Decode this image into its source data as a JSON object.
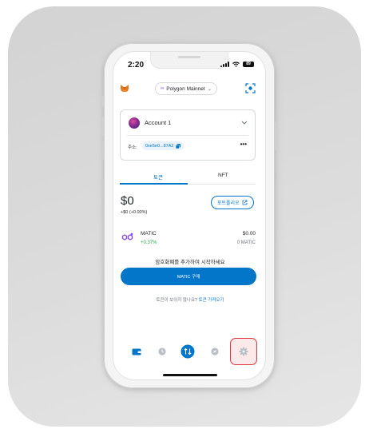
{
  "status_bar": {
    "time": "2:20",
    "battery_label": "89"
  },
  "header": {
    "network_name": "Polygon Mainnet",
    "network_chevron": "⌄"
  },
  "account": {
    "name": "Account 1",
    "address_label": "주소:",
    "address": "0xe5e0...87A2",
    "more": "•••"
  },
  "tabs": [
    {
      "label": "토큰",
      "active": true
    },
    {
      "label": "NFT",
      "active": false
    }
  ],
  "balance": {
    "amount": "$0",
    "change": "+$0 (+0.00%)",
    "portfolio_label": "포트폴리오"
  },
  "tokens": [
    {
      "name": "MATIC",
      "change": "+0.37%",
      "fiat": "$0.00",
      "amount": "0 MATIC"
    }
  ],
  "cta": {
    "text": "암호화폐를 추가하여 시작하세요",
    "buy_label": "MATIC 구매"
  },
  "import": {
    "prompt": "토큰이 보이지 않나요? ",
    "link": "토큰 가져오기"
  },
  "bottom_nav": [
    "wallet-icon",
    "clock-icon",
    "swap-icon",
    "compass-icon",
    "gear-icon"
  ],
  "colors": {
    "primary": "#0376c9",
    "positive": "#28a745",
    "highlight": "#e0353c",
    "polygon": "#8247e5"
  }
}
